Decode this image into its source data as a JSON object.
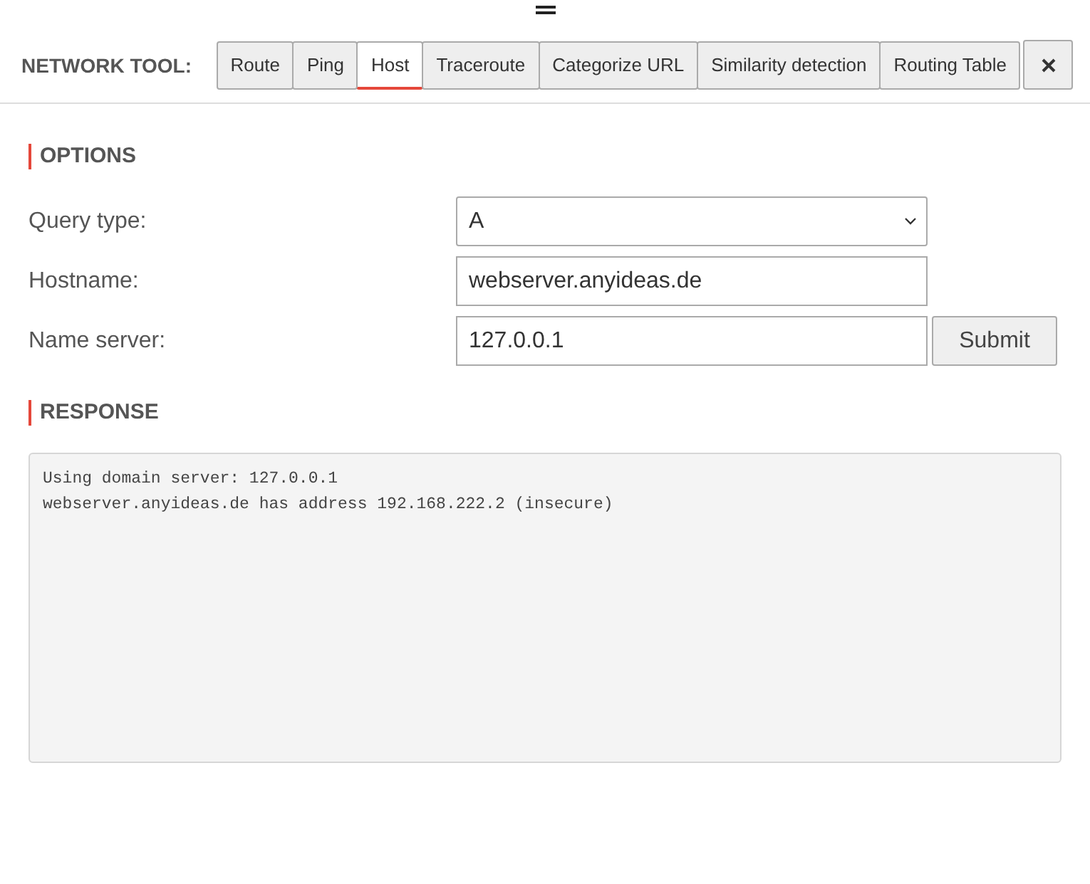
{
  "header": {
    "title": "NETWORK TOOL:",
    "tabs": [
      {
        "label": "Route",
        "selected": false
      },
      {
        "label": "Ping",
        "selected": false
      },
      {
        "label": "Host",
        "selected": true
      },
      {
        "label": "Traceroute",
        "selected": false
      },
      {
        "label": "Categorize URL",
        "selected": false
      },
      {
        "label": "Similarity detection",
        "selected": false
      },
      {
        "label": "Routing Table",
        "selected": false
      }
    ]
  },
  "options": {
    "heading": "OPTIONS",
    "fields": [
      {
        "kind": "select",
        "label": "Query type:",
        "value": "A"
      },
      {
        "kind": "text",
        "label": "Hostname:",
        "value": "webserver.anyideas.de"
      },
      {
        "kind": "text",
        "label": "Name server:",
        "value": "127.0.0.1",
        "action": "Submit"
      }
    ]
  },
  "response": {
    "heading": "RESPONSE",
    "lines": [
      "Using domain server: 127.0.0.1",
      "webserver.anyideas.de has address 192.168.222.2 (insecure)"
    ]
  }
}
